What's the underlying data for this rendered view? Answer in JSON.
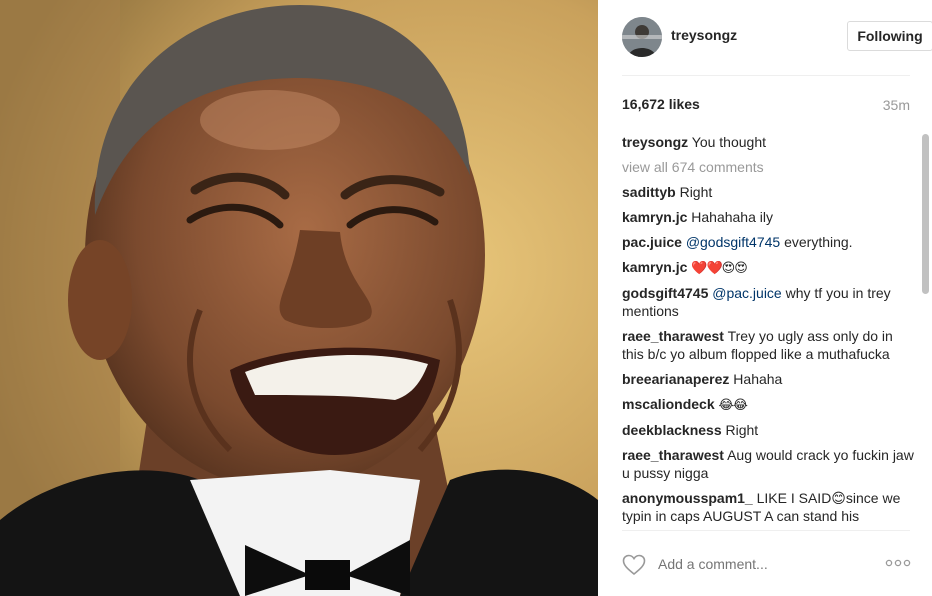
{
  "header": {
    "username": "treysongz",
    "follow_label": "Following"
  },
  "stats": {
    "likes": "16,672 likes",
    "time": "35m"
  },
  "caption": {
    "user": "treysongz",
    "text": "You thought"
  },
  "view_all": "view all 674 comments",
  "comments": [
    {
      "user": "sadittyb",
      "text": "Right"
    },
    {
      "user": "kamryn.jc",
      "text": "Hahahaha ily"
    },
    {
      "user": "pac.juice",
      "mention": "@godsgift4745",
      "text": "everything."
    },
    {
      "user": "kamryn.jc",
      "text": "❤️❤️😍😍"
    },
    {
      "user": "godsgift4745",
      "mention": "@pac.juice",
      "text": "why tf you in trey mentions"
    },
    {
      "user": "raee_tharawest",
      "text": "Trey yo ugly ass only do in this b/c yo album flopped like a muthafucka"
    },
    {
      "user": "breearianaperez",
      "text": "Hahaha"
    },
    {
      "user": "mscaliondeck",
      "text": "😂😂"
    },
    {
      "user": "deekblackness",
      "text": "Right"
    },
    {
      "user": "raee_tharawest",
      "text": "Aug would crack yo fuckin jaw u pussy nigga"
    },
    {
      "user": "anonymousspam1_",
      "text": "LIKE I SAID😊since we typin in caps AUGUST A can stand his"
    }
  ],
  "footer": {
    "add_comment_placeholder": "Add a comment...",
    "more_icon": "ellipsis-icon",
    "like_icon": "heart-outline-icon"
  },
  "colors": {
    "mention": "#003569",
    "muted": "#999999",
    "border": "#dbdbdb",
    "scrollbar": "#c1c1c1"
  }
}
